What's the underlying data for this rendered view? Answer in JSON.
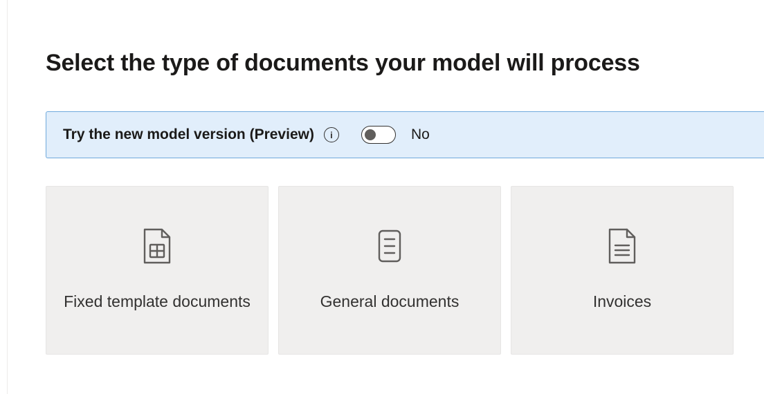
{
  "title": "Select the type of documents your model will process",
  "preview": {
    "label": "Try the new model version (Preview)",
    "state_label": "No",
    "enabled": false
  },
  "cards": [
    {
      "label": "Fixed template documents"
    },
    {
      "label": "General documents"
    },
    {
      "label": "Invoices"
    }
  ]
}
